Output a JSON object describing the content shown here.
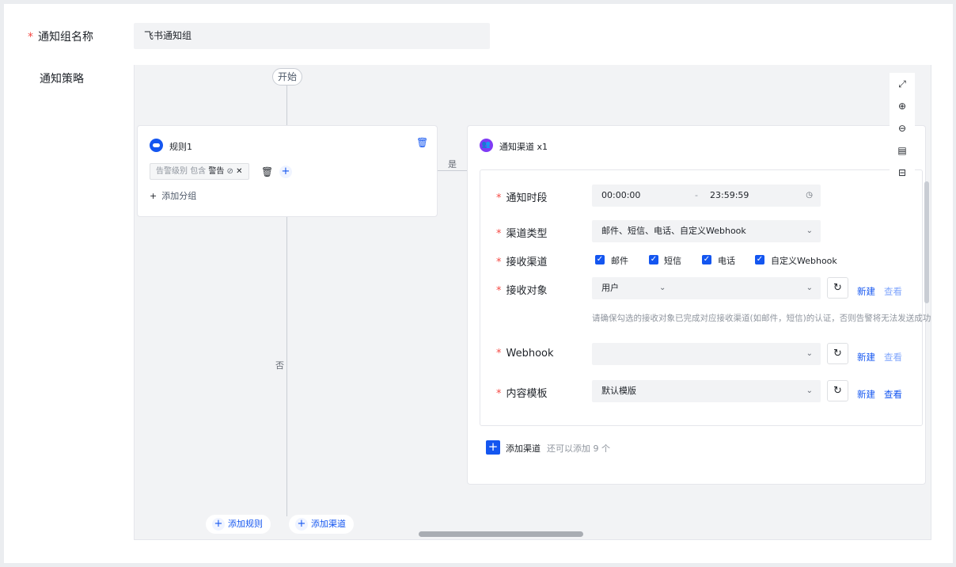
{
  "form": {
    "name_label": "通知组名称",
    "name_value": "飞书通知组",
    "strategy_label": "通知策略",
    "required_mark": "*"
  },
  "flow": {
    "start": "开始",
    "yes": "是",
    "no": "否",
    "add_rule": "添加规则",
    "add_channel": "添加渠道"
  },
  "rule": {
    "title": "规则1",
    "condition_field": "告警级别",
    "condition_op": "包含",
    "condition_value": "警告",
    "add_group": "添加分组"
  },
  "channel": {
    "title": "通知渠道",
    "count": "x1",
    "time_label": "通知时段",
    "time_start": "00:00:00",
    "time_sep": "-",
    "time_end": "23:59:59",
    "type_label": "渠道类型",
    "type_value": "邮件、短信、电话、自定义Webhook",
    "receive_label": "接收渠道",
    "receive_options": [
      "邮件",
      "短信",
      "电话",
      "自定义Webhook"
    ],
    "target_label": "接收对象",
    "target_value": "用户",
    "hint": "请确保勾选的接收对象已完成对应接收渠道(如邮件，短信)的认证，否则告警将无法发送成功。",
    "webhook_label": "Webhook",
    "webhook_value": "",
    "template_label": "内容模板",
    "template_value": "默认模版",
    "new_link": "新建",
    "view_link": "查看",
    "add_channel_btn": "添加渠道",
    "add_channel_hint": "还可以添加 9 个"
  }
}
